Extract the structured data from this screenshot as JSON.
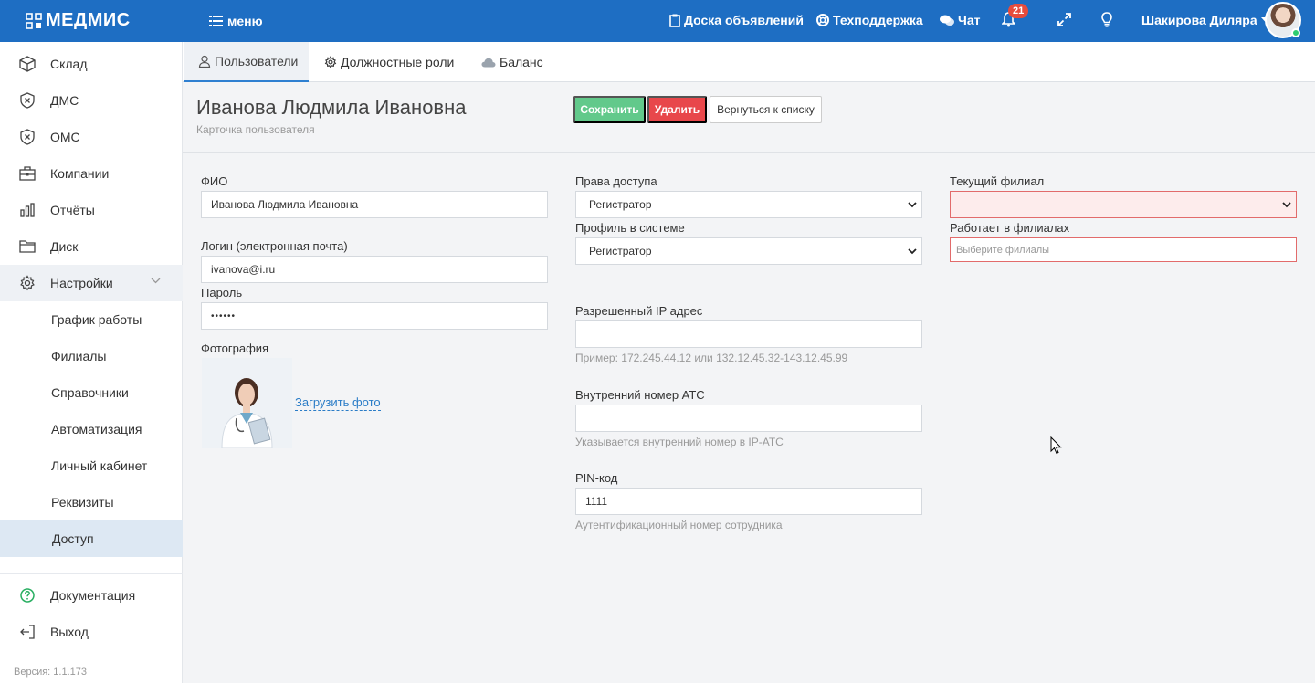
{
  "app": {
    "brand": "МЕДМИС",
    "menu_label": "меню"
  },
  "topnav": {
    "board": "Доска объявлений",
    "support": "Техподдержка",
    "chat": "Чат",
    "notifications_count": "21",
    "user_name": "Шакирова Диляра"
  },
  "sidebar": {
    "items": [
      {
        "label": "Склад",
        "icon": "box-icon"
      },
      {
        "label": "ДМС",
        "icon": "shield-icon"
      },
      {
        "label": "ОМС",
        "icon": "shield-icon"
      },
      {
        "label": "Компании",
        "icon": "briefcase-icon"
      },
      {
        "label": "Отчёты",
        "icon": "bar-chart-icon"
      },
      {
        "label": "Диск",
        "icon": "folder-icon"
      },
      {
        "label": "Настройки",
        "icon": "gear-icon"
      }
    ],
    "subitems": [
      "График работы",
      "Филиалы",
      "Справочники",
      "Автоматизация",
      "Личный кабинет",
      "Реквизиты",
      "Доступ"
    ],
    "docs_label": "Документация",
    "exit_label": "Выход",
    "version": "Версия: 1.1.173"
  },
  "tabs": {
    "users": "Пользователи",
    "roles": "Должностные роли",
    "balance": "Баланс"
  },
  "header": {
    "title": "Иванова Людмила Ивановна",
    "subtitle": "Карточка пользователя",
    "save": "Сохранить",
    "delete": "Удалить",
    "back": "Вернуться к списку"
  },
  "form": {
    "fio_label": "ФИО",
    "fio_value": "Иванова Людмила Ивановна",
    "login_label": "Логин (электронная почта)",
    "login_value": "ivanova@i.ru",
    "password_label": "Пароль",
    "password_value": "••••••",
    "photo_label": "Фотография",
    "upload_label": "Загрузить фото",
    "access_label": "Права доступа",
    "access_value": "Регистратор",
    "profile_label": "Профиль в системе",
    "profile_value": "Регистратор",
    "ip_label": "Разрешенный IP адрес",
    "ip_value": "",
    "ip_hint": "Пример: 172.245.44.12 или 132.12.45.32-143.12.45.99",
    "ext_label": "Внутренний номер АТС",
    "ext_value": "",
    "ext_hint": "Указывается внутренний номер в IP-АТС",
    "pin_label": "PIN-код",
    "pin_value": "1111",
    "pin_hint": "Аутентификационный номер сотрудника",
    "branch_label": "Текущий филиал",
    "branch_value": "",
    "branches_label": "Работает в филиалах",
    "branches_placeholder": "Выберите филиалы"
  },
  "colors": {
    "brand": "#1e6ec3",
    "save": "#62c98b",
    "delete": "#e8474b",
    "error_border": "#e26b6b",
    "link": "#2a7cc7"
  }
}
